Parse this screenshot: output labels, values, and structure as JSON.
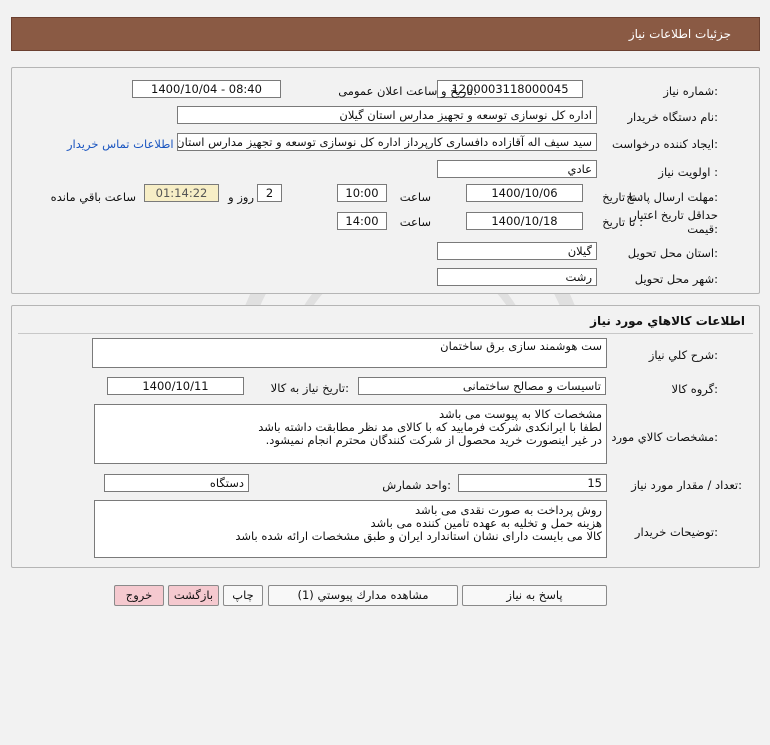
{
  "header": {
    "title": "جزئیات اطلاعات نیاز"
  },
  "need_info": {
    "need_number_label": "شماره نیاز:",
    "need_number": "1200003118000045",
    "announce_label": "تاریخ و ساعت اعلان عمومی:",
    "announce_value": "1400/10/04 - 08:40",
    "buyer_label": "نام دستگاه خریدار:",
    "buyer_value": "اداره کل نوسازی  توسعه و تجهیز مدارس استان گیلان",
    "requester_label": "ایجاد کننده درخواست:",
    "requester_value": "سید سیف اله آقازاده دافساری کارپرداز اداره کل نوسازی  توسعه و تجهیز مدارس استان گیلان",
    "contact_link": "اطلاعات تماس خریدار",
    "priority_label": "اولویت نیاز :",
    "priority_value": "عادي",
    "deadline_label": "مهلت ارسال پاسخ:",
    "deadline_to_label": "تا تاریخ :",
    "deadline_date": "1400/10/06",
    "time_label": "ساعت",
    "deadline_time": "10:00",
    "days_value": "2",
    "days_and_label": "روز و",
    "remaining_time": "01:14:22",
    "remaining_label": "ساعت باقي مانده",
    "validity_label_1": "حداقل تاریخ اعتبار",
    "validity_label_2": "قیمت:",
    "validity_to_label": "تا تاریخ :",
    "validity_date": "1400/10/18",
    "validity_time_label": "ساعت",
    "validity_time": "14:00",
    "province_label": "استان محل تحویل:",
    "province_value": "گیلان",
    "city_label": "شهر محل تحویل:",
    "city_value": "رشت"
  },
  "goods_info": {
    "title": "اطلاعات كالاهاي مورد نياز",
    "general_desc_label": "شرح كلي نياز:",
    "general_desc": "ست هوشمند سازی برق ساختمان",
    "group_label": "گروه كالا:",
    "group_value": "تاسیسات و مصالح ساختمانی",
    "need_date_label": "تاریخ نیاز به کالا:",
    "need_date": "1400/10/11",
    "specs_label": "مشخصات كالاي مورد نياز:",
    "specs_lines": [
      "مشخصات کالا به پیوست می باشد",
      "لطفا با ایرانکدی شرکت فرمایید که با کالای مد نظر مطابقت داشته باشد",
      "در غیر اینصورت خرید محصول از شرکت کنندگان محترم انجام نمیشود."
    ],
    "qty_label": "تعداد / مقدار مورد نیاز:",
    "qty_value": "15",
    "unit_label": "واحد شمارش:",
    "unit_value": "دستگاه",
    "buyer_notes_label": "توضيحات خريدار:",
    "buyer_notes_lines": [
      "روش پرداخت به صورت نقدی می باشد",
      "هزینه حمل و تخلیه به عهده تامین کننده می باشد",
      "کالا می بایست دارای نشان استاندارد ایران و طبق مشخصات ارائه شده باشد"
    ]
  },
  "buttons": {
    "reply": "پاسخ به نیاز",
    "attachments": "مشاهده مدارك پيوستي (1)",
    "print": "چاپ",
    "back": "بازگشت",
    "exit": "خروج"
  }
}
